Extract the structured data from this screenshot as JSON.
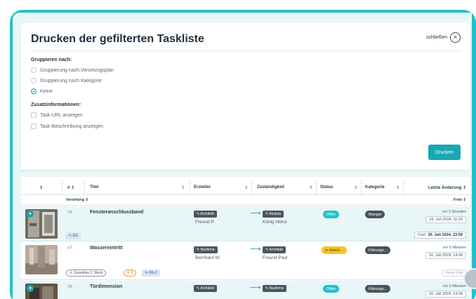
{
  "modal": {
    "title": "Drucken der gefilterten Taskliste",
    "close_label": "schließen",
    "group_label": "Gruppieren nach:",
    "group_options": [
      {
        "label": "Gruppierung nach Verortungsplan",
        "selected": false
      },
      {
        "label": "Gruppierung nach Kategorie",
        "selected": false
      },
      {
        "label": "Keine",
        "selected": true
      }
    ],
    "extra_label": "Zusatzinformationen:",
    "extra_options": [
      {
        "label": "Task-URL anzeigen",
        "checked": false
      },
      {
        "label": "Task-Beschreibung anzeigen",
        "checked": false
      }
    ],
    "print_button": "Drucken"
  },
  "table": {
    "headers": {
      "sort": "⇕",
      "number": "# ⇕",
      "title": "Titel",
      "creator": "Ersteller",
      "responsible": "Zuständigkeit",
      "status": "Status",
      "category": "Kategorie",
      "last_change": "Letzte Änderung ⇕"
    },
    "subheader": {
      "left": "Verortung ⇕",
      "right": "Frist ⇕"
    },
    "rows": [
      {
        "num": "#8",
        "title": "Fensteranschlussband",
        "creator_role": "✎ Architekt",
        "creator_name": "Freund P.",
        "resp_role": "✎ Akubau",
        "resp_name": "König Heinz",
        "status": "Offen",
        "category": "Mangel",
        "when": "vor 3 Stunden",
        "date": "16. Juli 2024, 11:33",
        "tags": [
          "✎ EG"
        ],
        "frist_label": "Frist:",
        "frist_value": "30. Juli 2024, 23:59"
      },
      {
        "num": "#7",
        "title": "Wassereintritt",
        "creator_role": "✎ Baufirma",
        "creator_name": "Bernhard W.",
        "resp_role": "✎ Architekt",
        "resp_name": "Freund Paul",
        "status": "In Abklär...",
        "category": "Klärungs...",
        "when": "vor 6 Minuten",
        "date": "16. Juli 2024, 14:34",
        "location": "Grundriss 2. Stock",
        "count": "2",
        "tags": [
          "✎ OG-2"
        ],
        "frist_none": "Keine Frist"
      },
      {
        "num": "#6",
        "title": "Türdimension",
        "creator_role": "✎ Architekt",
        "resp_role": "✎ Baufirma",
        "status": "Offen",
        "category": "Klärungs...",
        "when": "vor 6 Minuten",
        "date": "16. Juli 2024, 14:34"
      }
    ]
  },
  "colors": {
    "accent": "#1aa7b3",
    "frame": "#23c0c9",
    "status_open": "#22c1cc",
    "status_clarify": "#f7c526",
    "tag_dark": "#4b5660"
  }
}
